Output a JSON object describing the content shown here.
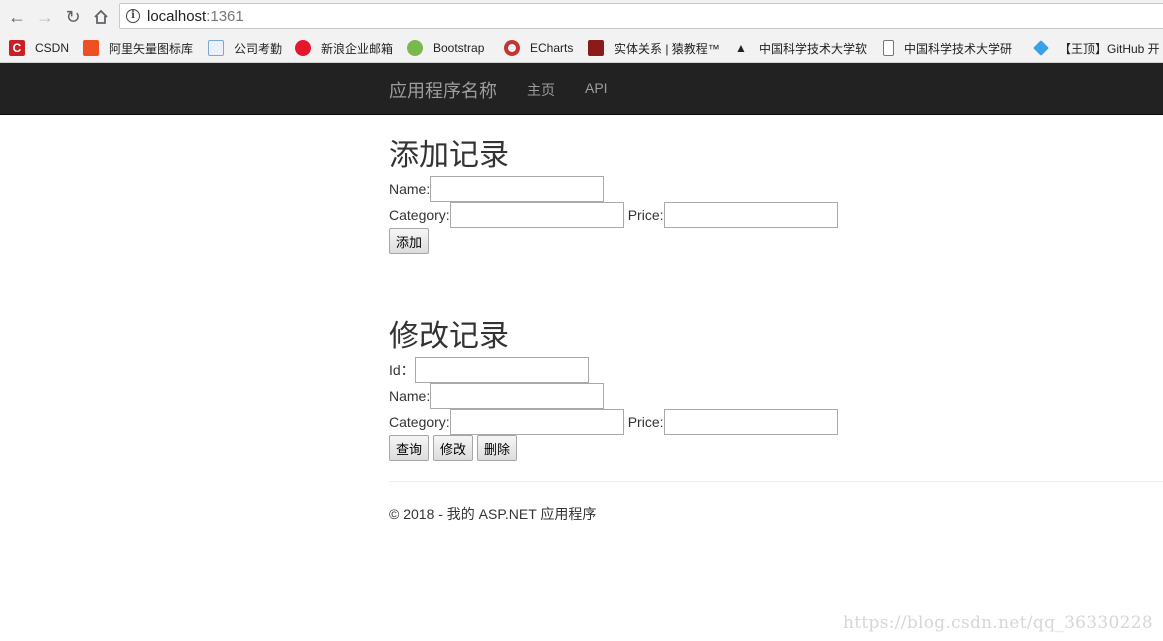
{
  "browser": {
    "url_host": "localhost",
    "url_port": ":1361",
    "bookmarks": [
      {
        "label": "CSDN",
        "icon": "csdn-icon",
        "color": "#c92027"
      },
      {
        "label": "阿里矢量图标库",
        "icon": "iconfont-icon",
        "color": "#f04e23"
      },
      {
        "label": "公司考勤",
        "icon": "page-icon",
        "color": "#7aa7d9"
      },
      {
        "label": "新浪企业邮箱",
        "icon": "weibo-icon",
        "color": "#e6162d"
      },
      {
        "label": "Bootstrap",
        "icon": "bootstrap-icon",
        "color": "#79b84d"
      },
      {
        "label": "ECharts",
        "icon": "echarts-icon",
        "color": "#c23531"
      },
      {
        "label": "实体关系 | 猿教程™",
        "icon": "yuan-icon",
        "color": "#8b1a1a"
      },
      {
        "label": "中国科学技术大学软",
        "icon": "graduation-cap-icon",
        "color": "#333333"
      },
      {
        "label": "中国科学技术大学研",
        "icon": "blank-page-icon",
        "color": "#777777"
      },
      {
        "label": "【王顶】GitHub 开",
        "icon": "diamond-icon",
        "color": "#3aa0e8"
      }
    ]
  },
  "navbar": {
    "brand": "应用程序名称",
    "links": [
      "主页",
      "API"
    ]
  },
  "add_section": {
    "title": "添加记录",
    "name_label": "Name:",
    "category_label": "Category:",
    "price_label": "Price:",
    "add_button": "添加"
  },
  "edit_section": {
    "title": "修改记录",
    "id_label": "Id：",
    "name_label": "Name:",
    "category_label": "Category:",
    "price_label": "Price:",
    "query_button": "查询",
    "update_button": "修改",
    "delete_button": "删除"
  },
  "footer": {
    "text": "© 2018 - 我的 ASP.NET 应用程序"
  },
  "watermark": "https://blog.csdn.net/qq_36330228",
  "colors": {
    "navbar_bg": "#222222",
    "navbar_text": "#9d9d9d"
  }
}
